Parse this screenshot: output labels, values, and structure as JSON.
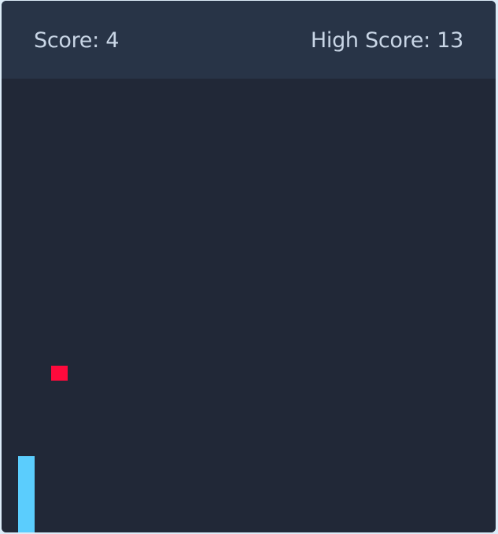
{
  "scoreboard": {
    "score_label": "Score: 4",
    "high_score_label": "High Score: 13"
  },
  "colors": {
    "background": "#212837",
    "header": "#283447",
    "text": "#c9d6e6",
    "snake": "#5bcdfd",
    "food": "#ff0a3c"
  },
  "entities": {
    "snake_icon": "snake-body",
    "food_icon": "food-square"
  }
}
